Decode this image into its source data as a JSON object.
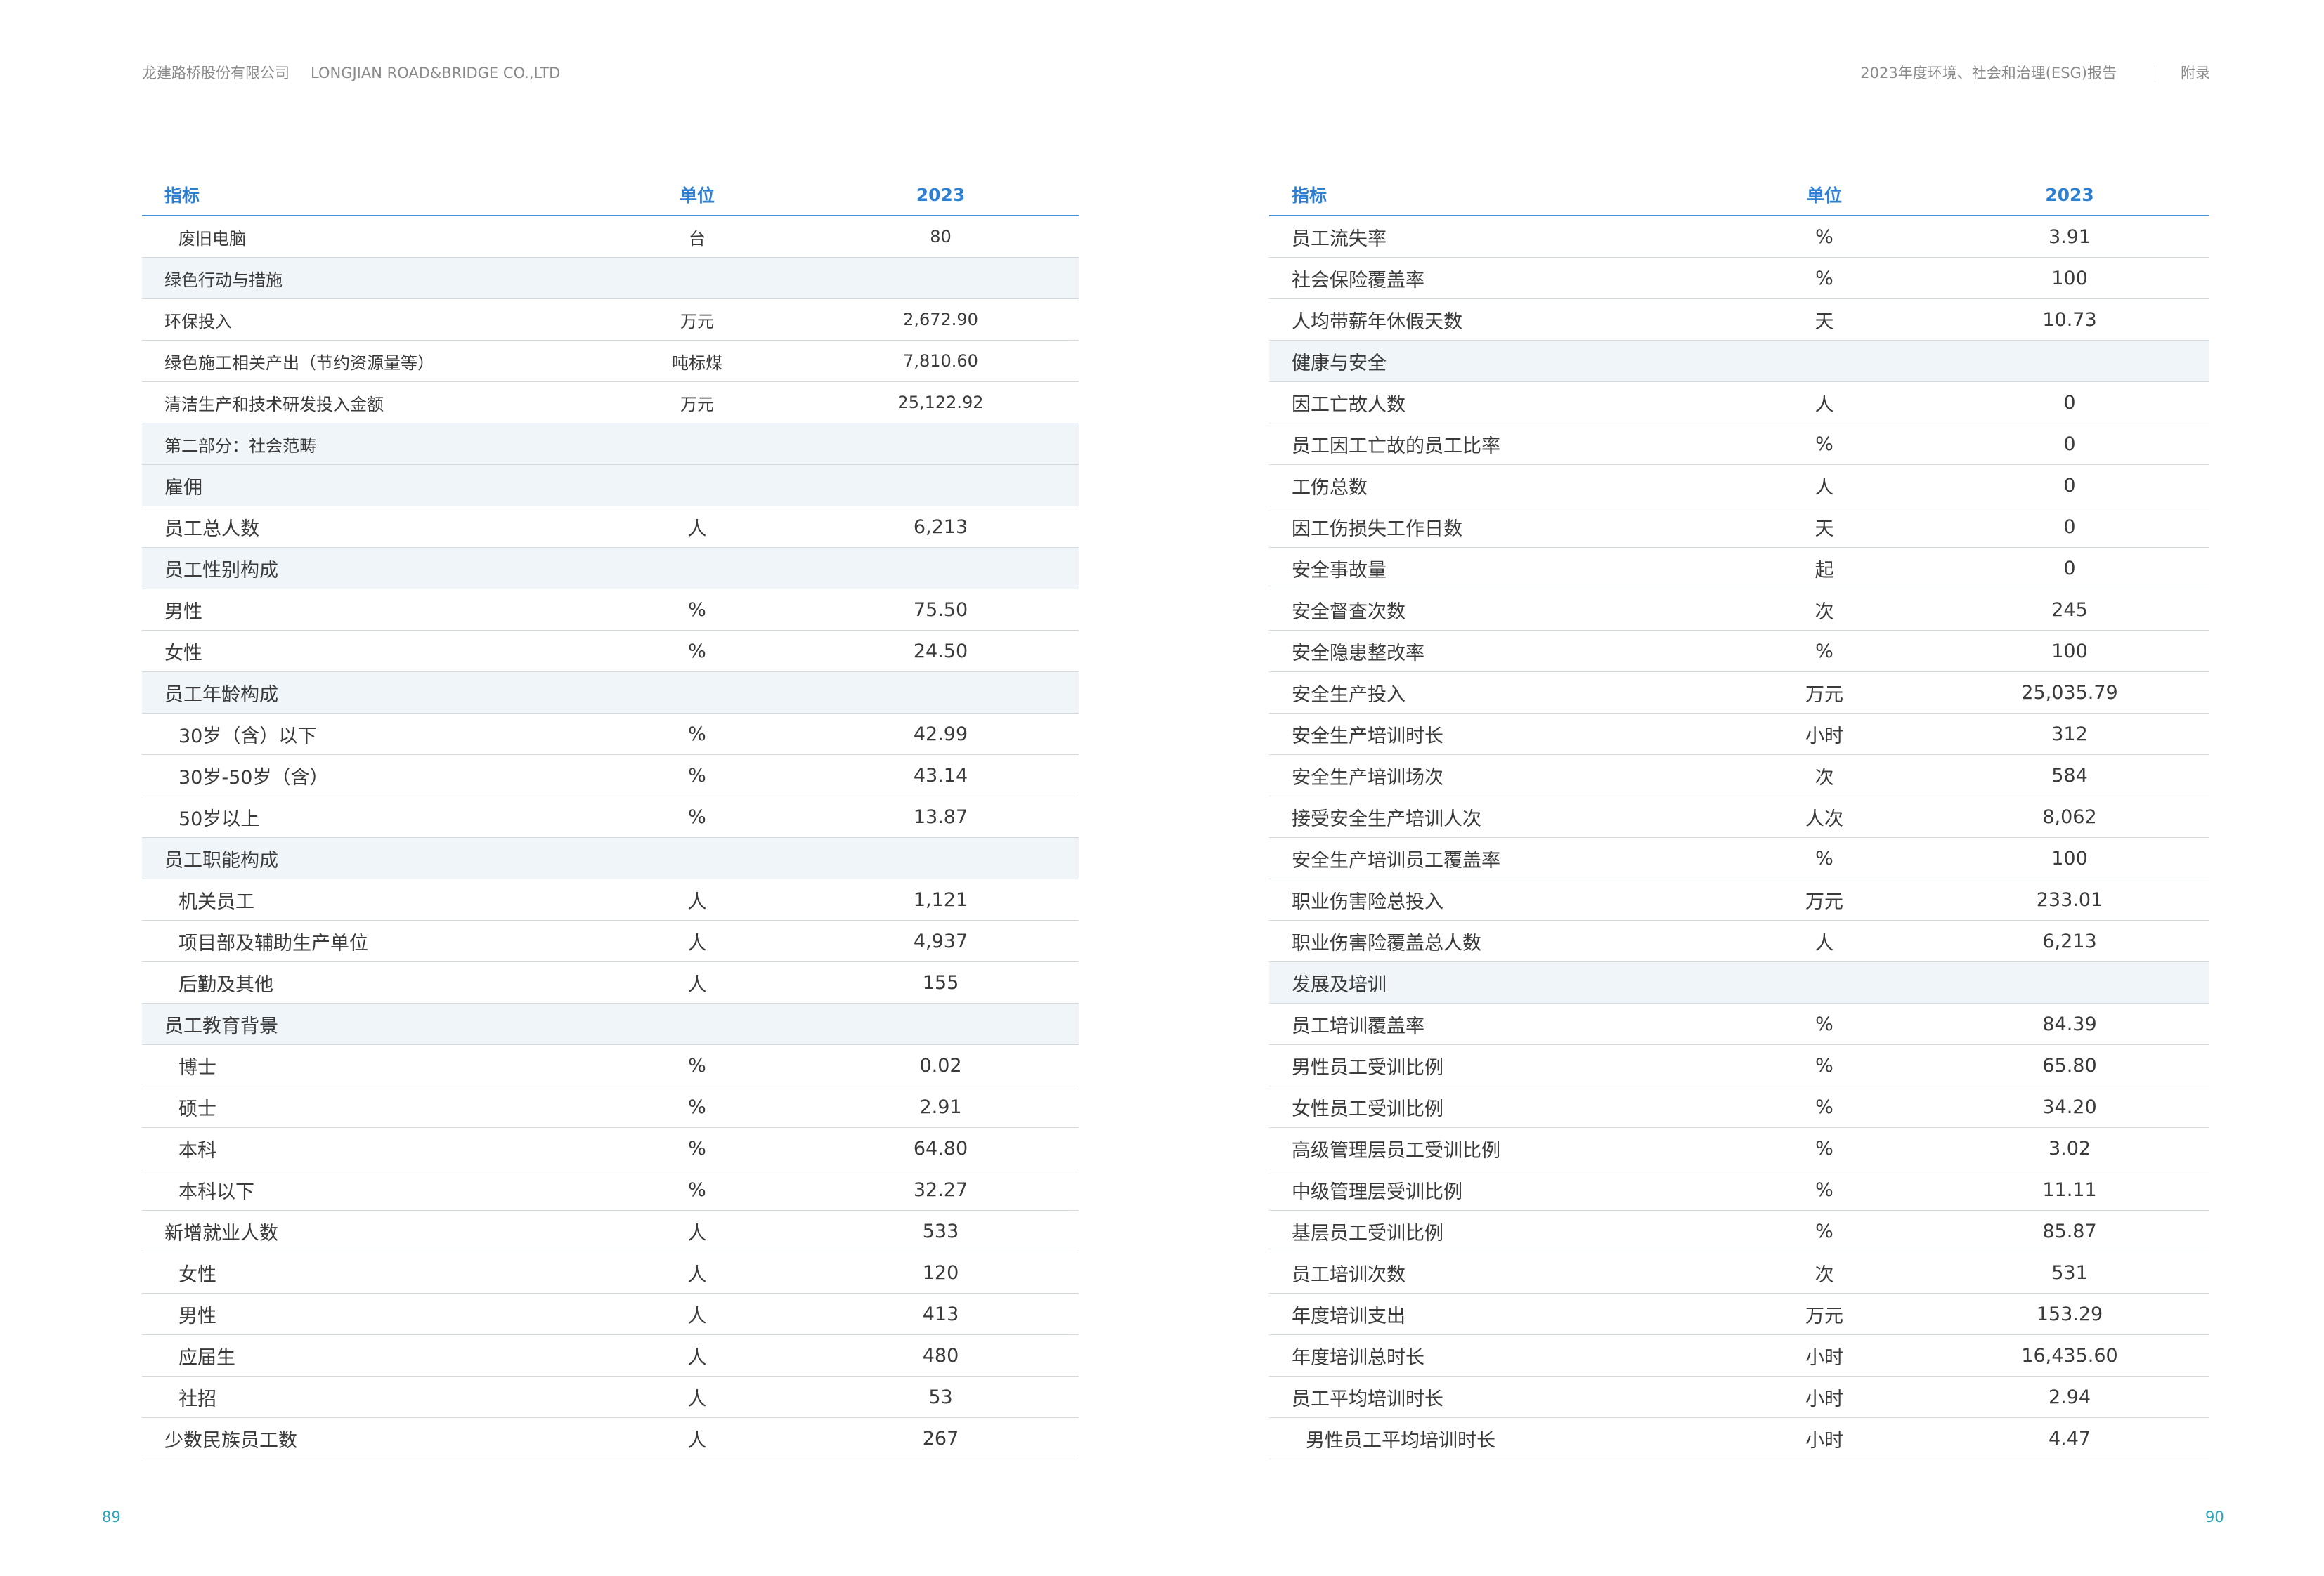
{
  "header": {
    "company_cn": "龙建路桥股份有限公司",
    "company_en": "LONGJIAN ROAD&BRIDGE CO.,LTD",
    "report_title": "2023年度环境、社会和治理(ESG)报告",
    "section": "附录"
  },
  "page_numbers": {
    "left": "89",
    "right": "90"
  },
  "columns": {
    "indicator": "指标",
    "unit": "单位",
    "year": "2023"
  },
  "left_rows": [
    {
      "label": "废旧电脑",
      "unit": "台",
      "value": "80"
    },
    {
      "label": "绿色行动与措施",
      "unit": "",
      "value": ""
    },
    {
      "label": "环保投入",
      "unit": "万元",
      "value": "2,672.90"
    },
    {
      "label": "绿色施工相关产出（节约资源量等）",
      "unit": "吨标煤",
      "value": "7,810.60"
    },
    {
      "label": "清洁生产和技术研发投入金额",
      "unit": "万元",
      "value": "25,122.92"
    },
    {
      "label": "第二部分：社会范畴",
      "unit": "",
      "value": ""
    },
    {
      "label": "雇佣",
      "unit": "",
      "value": ""
    },
    {
      "label": "员工总人数",
      "unit": "人",
      "value": "6,213"
    },
    {
      "label": "员工性别构成",
      "unit": "",
      "value": ""
    },
    {
      "label": "男性",
      "unit": "%",
      "value": "75.50"
    },
    {
      "label": "女性",
      "unit": "%",
      "value": "24.50"
    },
    {
      "label": "员工年龄构成",
      "unit": "",
      "value": ""
    },
    {
      "label": "30岁（含）以下",
      "unit": "%",
      "value": "42.99"
    },
    {
      "label": "30岁-50岁（含）",
      "unit": "%",
      "value": "43.14"
    },
    {
      "label": "50岁以上",
      "unit": "%",
      "value": "13.87"
    },
    {
      "label": "员工职能构成",
      "unit": "",
      "value": ""
    },
    {
      "label": "机关员工",
      "unit": "人",
      "value": "1,121"
    },
    {
      "label": "项目部及辅助生产单位",
      "unit": "人",
      "value": "4,937"
    },
    {
      "label": "后勤及其他",
      "unit": "人",
      "value": "155"
    },
    {
      "label": "员工教育背景",
      "unit": "",
      "value": ""
    },
    {
      "label": "博士",
      "unit": "%",
      "value": "0.02"
    },
    {
      "label": "硕士",
      "unit": "%",
      "value": "2.91"
    },
    {
      "label": "本科",
      "unit": "%",
      "value": "64.80"
    },
    {
      "label": "本科以下",
      "unit": "%",
      "value": "32.27"
    },
    {
      "label": "新增就业人数",
      "unit": "人",
      "value": "533"
    },
    {
      "label": "女性",
      "unit": "人",
      "value": "120"
    },
    {
      "label": "男性",
      "unit": "人",
      "value": "413"
    },
    {
      "label": "应届生",
      "unit": "人",
      "value": "480"
    },
    {
      "label": "社招",
      "unit": "人",
      "value": "53"
    },
    {
      "label": "少数民族员工数",
      "unit": "人",
      "value": "267"
    }
  ],
  "right_rows": [
    {
      "label": "员工流失率",
      "unit": "%",
      "value": "3.91"
    },
    {
      "label": "社会保险覆盖率",
      "unit": "%",
      "value": "100"
    },
    {
      "label": "人均带薪年休假天数",
      "unit": "天",
      "value": "10.73"
    },
    {
      "label": "健康与安全",
      "unit": "",
      "value": ""
    },
    {
      "label": "因工亡故人数",
      "unit": "人",
      "value": "0"
    },
    {
      "label": "员工因工亡故的员工比率",
      "unit": "%",
      "value": "0"
    },
    {
      "label": "工伤总数",
      "unit": "人",
      "value": "0"
    },
    {
      "label": "因工伤损失工作日数",
      "unit": "天",
      "value": "0"
    },
    {
      "label": "安全事故量",
      "unit": "起",
      "value": "0"
    },
    {
      "label": "安全督查次数",
      "unit": "次",
      "value": "245"
    },
    {
      "label": "安全隐患整改率",
      "unit": "%",
      "value": "100"
    },
    {
      "label": "安全生产投入",
      "unit": "万元",
      "value": "25,035.79"
    },
    {
      "label": "安全生产培训时长",
      "unit": "小时",
      "value": "312"
    },
    {
      "label": "安全生产培训场次",
      "unit": "次",
      "value": "584"
    },
    {
      "label": "接受安全生产培训人次",
      "unit": "人次",
      "value": "8,062"
    },
    {
      "label": "安全生产培训员工覆盖率",
      "unit": "%",
      "value": "100"
    },
    {
      "label": "职业伤害险总投入",
      "unit": "万元",
      "value": "233.01"
    },
    {
      "label": "职业伤害险覆盖总人数",
      "unit": "人",
      "value": "6,213"
    },
    {
      "label": "发展及培训",
      "unit": "",
      "value": ""
    },
    {
      "label": "员工培训覆盖率",
      "unit": "%",
      "value": "84.39"
    },
    {
      "label": "男性员工受训比例",
      "unit": "%",
      "value": "65.80"
    },
    {
      "label": "女性员工受训比例",
      "unit": "%",
      "value": "34.20"
    },
    {
      "label": "高级管理层员工受训比例",
      "unit": "%",
      "value": "3.02"
    },
    {
      "label": "中级管理层受训比例",
      "unit": "%",
      "value": "11.11"
    },
    {
      "label": "基层员工受训比例",
      "unit": "%",
      "value": "85.87"
    },
    {
      "label": "员工培训次数",
      "unit": "次",
      "value": "531"
    },
    {
      "label": "年度培训支出",
      "unit": "万元",
      "value": "153.29"
    },
    {
      "label": "年度培训总时长",
      "unit": "小时",
      "value": "16,435.60"
    },
    {
      "label": "员工平均培训时长",
      "unit": "小时",
      "value": "2.94"
    },
    {
      "label": "男性员工平均培训时长",
      "unit": "小时",
      "value": "4.47"
    }
  ]
}
